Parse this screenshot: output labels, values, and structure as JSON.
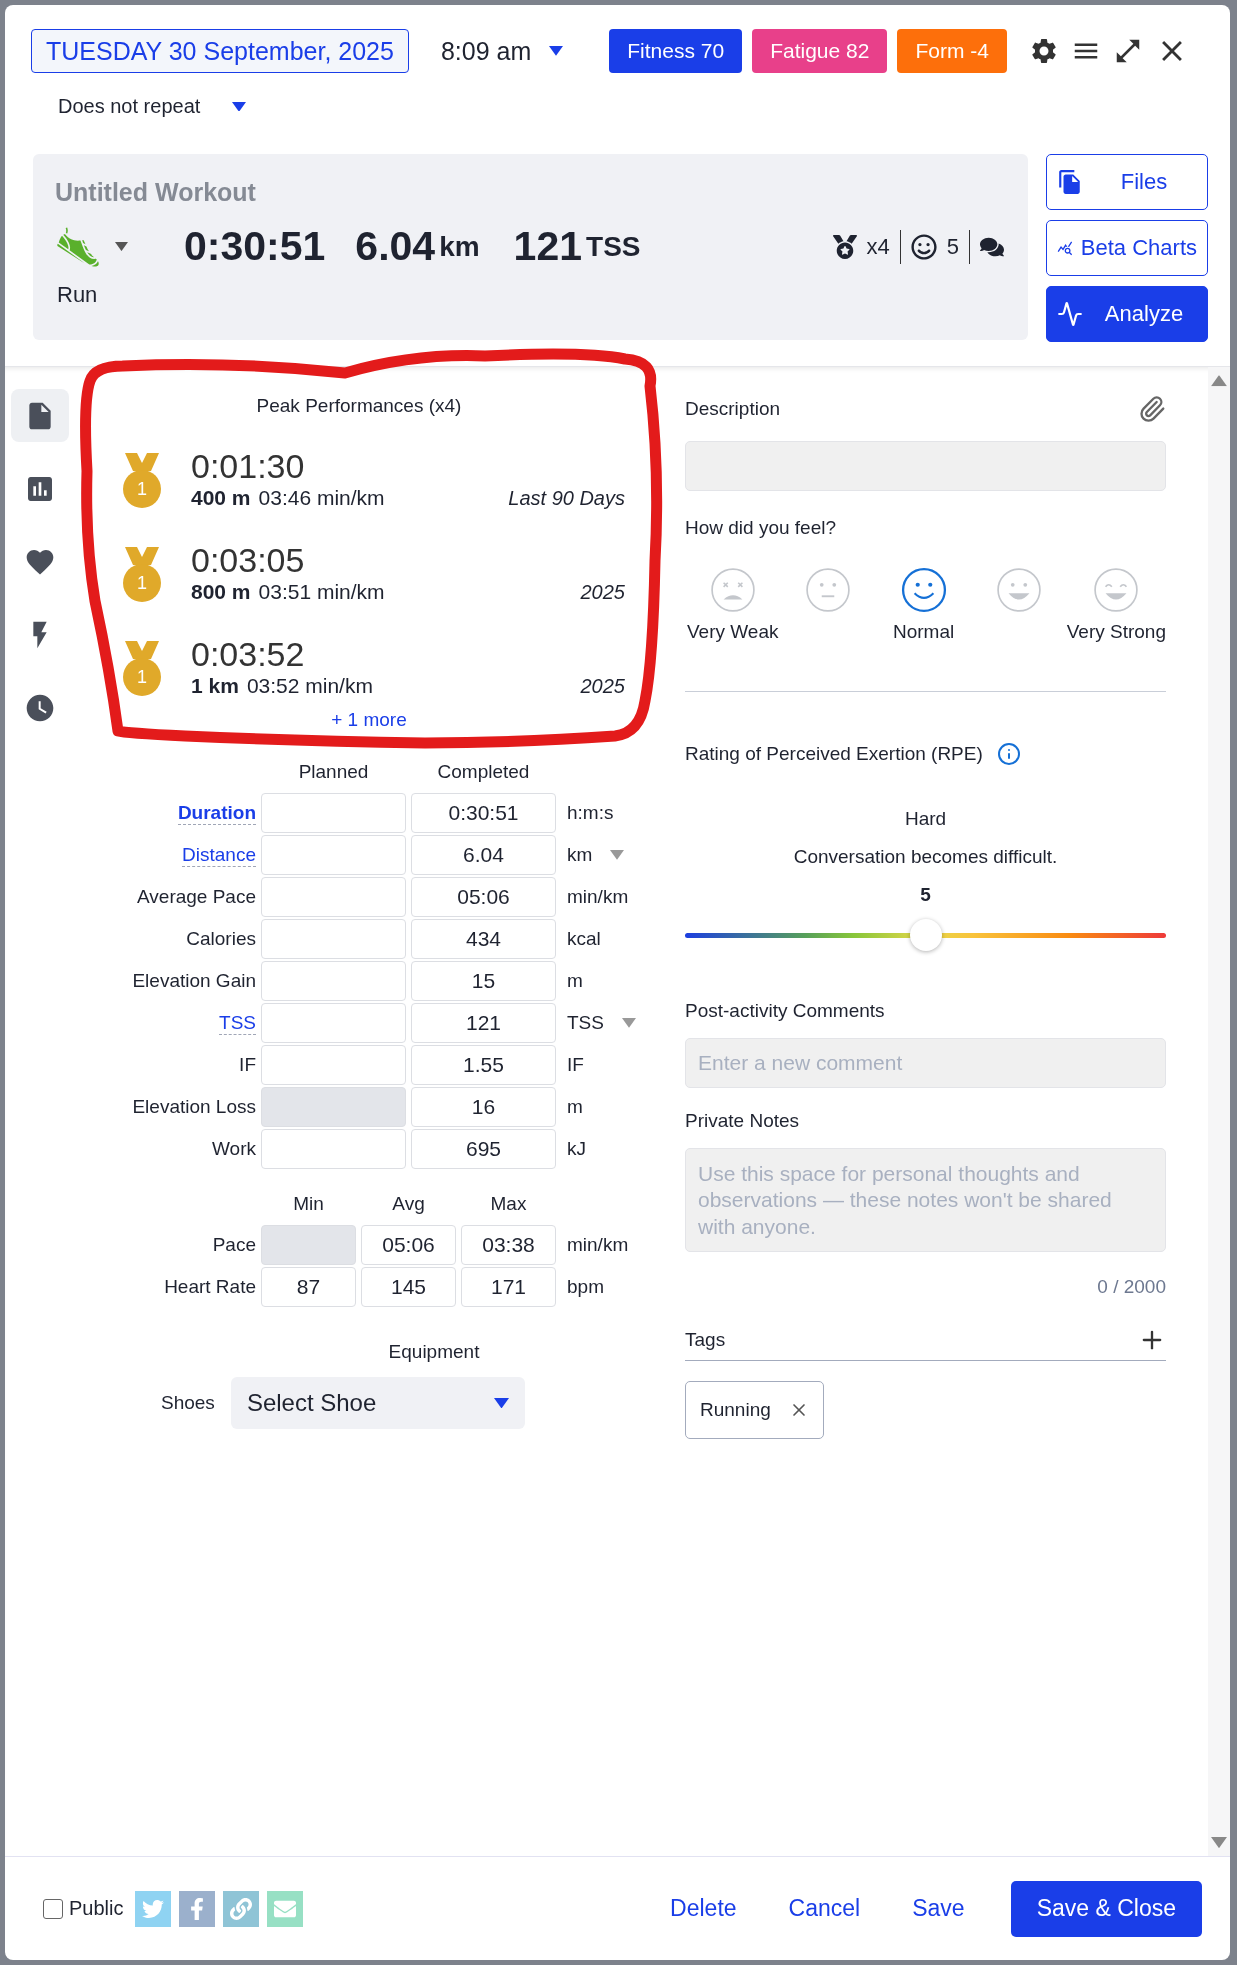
{
  "header": {
    "date": "TUESDAY 30 September, 2025",
    "time": "8:09 am",
    "repeat": "Does not repeat",
    "badges": [
      {
        "label": "Fitness 70",
        "color": "#1a3ee8"
      },
      {
        "label": "Fatigue 82",
        "color": "#e8408a"
      },
      {
        "label": "Form -4",
        "color": "#fd6f0b"
      }
    ]
  },
  "summary": {
    "title": "Untitled Workout",
    "sport": "Run",
    "duration": "0:30:51",
    "distance": "6.04",
    "distance_unit": "km",
    "tss": "121",
    "tss_unit": "TSS",
    "medals": "x4",
    "feel": "5"
  },
  "actions": [
    {
      "label": "Files",
      "kind": "files"
    },
    {
      "label": "Beta Charts",
      "kind": "charts"
    },
    {
      "label": "Analyze",
      "kind": "analyze"
    }
  ],
  "rail": [
    {
      "kind": "file",
      "selected": true
    },
    {
      "kind": "chart",
      "selected": false
    },
    {
      "kind": "heart",
      "selected": false
    },
    {
      "kind": "bolt",
      "selected": false
    },
    {
      "kind": "clock",
      "selected": false
    }
  ],
  "peak": {
    "title": "Peak Performances (x4)",
    "more": "+ 1 more",
    "items": [
      {
        "rank": "1",
        "time": "0:01:30",
        "distance": "400 m",
        "pace": "03:46 min/km",
        "period": "Last 90 Days"
      },
      {
        "rank": "1",
        "time": "0:03:05",
        "distance": "800 m",
        "pace": "03:51 min/km",
        "period": "2025"
      },
      {
        "rank": "1",
        "time": "0:03:52",
        "distance": "1 km",
        "pace": "03:52 min/km",
        "period": "2025"
      }
    ]
  },
  "metrics": {
    "columns": [
      "Planned",
      "Completed"
    ],
    "rows": [
      {
        "label": "Duration",
        "kind": "strong-link",
        "planned_disabled": false,
        "completed": "0:30:51",
        "unit": "h:m:s",
        "unit_menu": false
      },
      {
        "label": "Distance",
        "kind": "link",
        "planned_disabled": false,
        "completed": "6.04",
        "unit": "km",
        "unit_menu": true
      },
      {
        "label": "Average Pace",
        "kind": "plain",
        "planned_disabled": false,
        "completed": "05:06",
        "unit": "min/km",
        "unit_menu": false
      },
      {
        "label": "Calories",
        "kind": "plain",
        "planned_disabled": false,
        "completed": "434",
        "unit": "kcal",
        "unit_menu": false
      },
      {
        "label": "Elevation Gain",
        "kind": "plain",
        "planned_disabled": false,
        "completed": "15",
        "unit": "m",
        "unit_menu": false
      },
      {
        "label": "TSS",
        "kind": "link",
        "planned_disabled": false,
        "completed": "121",
        "unit": "TSS",
        "unit_menu": true
      },
      {
        "label": "IF",
        "kind": "plain",
        "planned_disabled": false,
        "completed": "1.55",
        "unit": "IF",
        "unit_menu": false
      },
      {
        "label": "Elevation Loss",
        "kind": "plain",
        "planned_disabled": true,
        "completed": "16",
        "unit": "m",
        "unit_menu": false
      },
      {
        "label": "Work",
        "kind": "plain",
        "planned_disabled": false,
        "completed": "695",
        "unit": "kJ",
        "unit_menu": false
      }
    ]
  },
  "ranges": {
    "columns": [
      "Min",
      "Avg",
      "Max"
    ],
    "rows": [
      {
        "label": "Pace",
        "unit": "min/km",
        "cells": [
          {
            "disabled": true
          },
          {
            "text": "05:06",
            "disabled": false
          },
          {
            "text": "03:38",
            "disabled": false
          }
        ]
      },
      {
        "label": "Heart Rate",
        "unit": "bpm",
        "cells": [
          {
            "text": "87",
            "disabled": false
          },
          {
            "text": "145",
            "disabled": false
          },
          {
            "text": "171",
            "disabled": false
          }
        ]
      }
    ]
  },
  "equipment": {
    "title": "Equipment",
    "label": "Shoes",
    "value": "Select Shoe"
  },
  "description": {
    "label": "Description"
  },
  "feel": {
    "label": "How did you feel?",
    "options": [
      {
        "kind": "dizzy",
        "label": "Very Weak",
        "selected": false
      },
      {
        "kind": "neutral",
        "selected": false
      },
      {
        "kind": "smile",
        "label": "Normal",
        "selected": true
      },
      {
        "kind": "grin",
        "selected": false
      },
      {
        "kind": "beam",
        "label": "Very Strong",
        "selected": false
      }
    ]
  },
  "rpe": {
    "label": "Rating of Perceived Exertion (RPE)",
    "name": "Hard",
    "hint": "Conversation becomes difficult.",
    "value": "5",
    "level": 0.5
  },
  "comments": {
    "label": "Post-activity Comments",
    "placeholder": "Enter a new comment"
  },
  "notes": {
    "label": "Private Notes",
    "placeholder": "Use this space for personal thoughts and observations — these notes won't be shared with anyone.",
    "counter": "0 / 2000"
  },
  "tags": {
    "label": "Tags",
    "items": [
      "Running"
    ]
  },
  "footer": {
    "public": {
      "label": "Public",
      "checked": false
    },
    "share": [
      {
        "kind": "twitter"
      },
      {
        "kind": "facebook"
      },
      {
        "kind": "link"
      },
      {
        "kind": "email"
      }
    ],
    "buttons": [
      {
        "label": "Delete",
        "kind": "link"
      },
      {
        "label": "Cancel",
        "kind": "link"
      },
      {
        "label": "Save",
        "kind": "link"
      },
      {
        "label": "Save & Close",
        "kind": "primary"
      }
    ]
  }
}
